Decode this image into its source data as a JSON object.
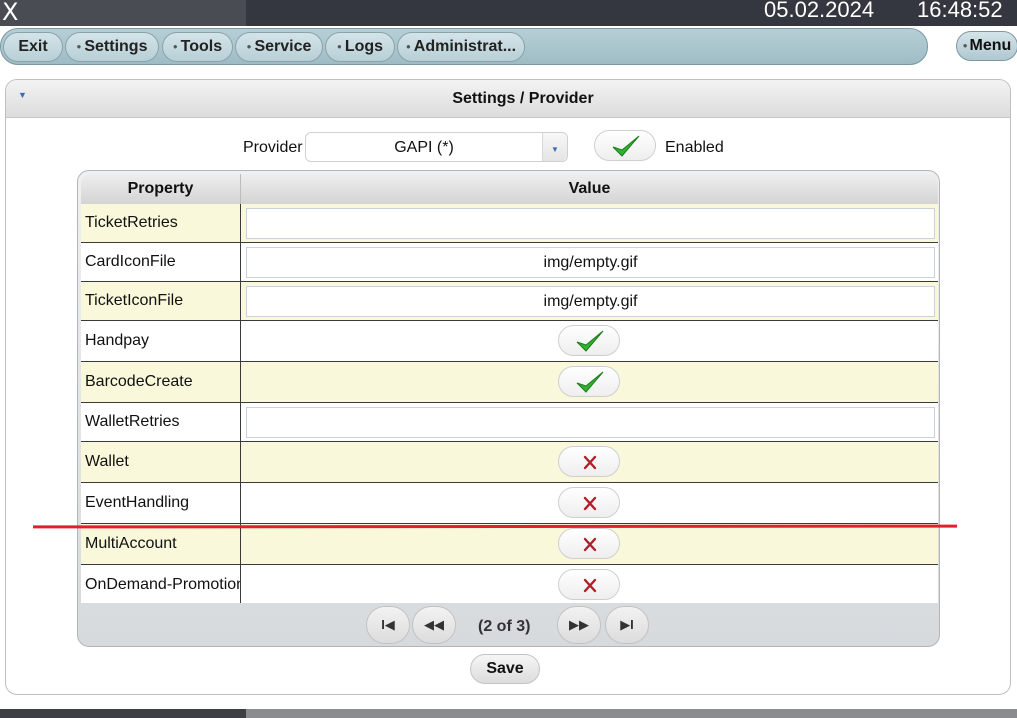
{
  "window": {
    "close_label": "X",
    "date": "05.02.2024",
    "time": "16:48:52"
  },
  "nav": {
    "items": [
      {
        "label": "Exit"
      },
      {
        "label": "Settings"
      },
      {
        "label": "Tools"
      },
      {
        "label": "Service"
      },
      {
        "label": "Logs"
      },
      {
        "label": "Administrat..."
      }
    ],
    "menu_label": "Menu"
  },
  "panel": {
    "title": "Settings / Provider"
  },
  "provider": {
    "label": "Provider",
    "value": "GAPI (*)",
    "enabled_label": "Enabled",
    "enabled": true
  },
  "table": {
    "headers": {
      "property": "Property",
      "value": "Value"
    },
    "rows": [
      {
        "property": "TicketRetries",
        "type": "text",
        "value": ""
      },
      {
        "property": "CardIconFile",
        "type": "text",
        "value": "img/empty.gif"
      },
      {
        "property": "TicketIconFile",
        "type": "text",
        "value": "img/empty.gif"
      },
      {
        "property": "Handpay",
        "type": "bool",
        "value": true
      },
      {
        "property": "BarcodeCreate",
        "type": "bool",
        "value": true
      },
      {
        "property": "WalletRetries",
        "type": "text",
        "value": ""
      },
      {
        "property": "Wallet",
        "type": "bool",
        "value": false
      },
      {
        "property": "EventHandling",
        "type": "bool",
        "value": false
      },
      {
        "property": "MultiAccount",
        "type": "bool",
        "value": false
      },
      {
        "property": "OnDemand-Promotion",
        "type": "bool",
        "value": false
      }
    ]
  },
  "pager": {
    "first": "I◀",
    "prev": "◀◀",
    "status": "(2 of 3)",
    "next": "▶▶",
    "last": "▶I"
  },
  "save_label": "Save",
  "colors": {
    "check": "#2fb32f",
    "cross": "#b0202a",
    "alt_row": "#f9f8da",
    "annotation": "#e0202a"
  }
}
